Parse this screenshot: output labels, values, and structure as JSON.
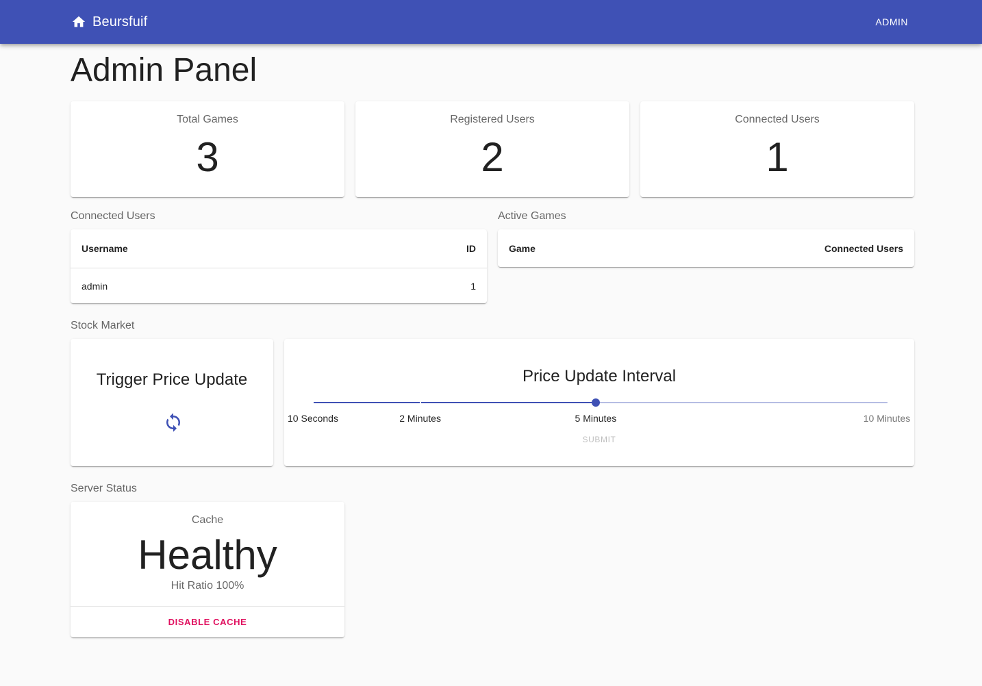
{
  "appbar": {
    "brand": "Beursfuif",
    "nav_admin": "ADMIN",
    "color": "#3f51b5"
  },
  "page": {
    "title": "Admin Panel"
  },
  "stats": [
    {
      "label": "Total Games",
      "value": "3"
    },
    {
      "label": "Registered Users",
      "value": "2"
    },
    {
      "label": "Connected Users",
      "value": "1"
    }
  ],
  "connected_users": {
    "section_label": "Connected Users",
    "columns": [
      "Username",
      "ID"
    ],
    "rows": [
      {
        "username": "admin",
        "id": "1"
      }
    ]
  },
  "active_games": {
    "section_label": "Active Games",
    "columns": [
      "Game",
      "Connected Users"
    ],
    "rows": []
  },
  "stock_market": {
    "section_label": "Stock Market",
    "trigger_title": "Trigger Price Update",
    "refresh_icon": "refresh-icon",
    "interval": {
      "title": "Price Update Interval",
      "marks": [
        {
          "label": "10 Seconds",
          "seconds": 10
        },
        {
          "label": "2 Minutes",
          "seconds": 120
        },
        {
          "label": "5 Minutes",
          "seconds": 300
        },
        {
          "label": "10 Minutes",
          "seconds": 600
        }
      ],
      "selected_seconds": 300,
      "submit_label": "SUBMIT"
    }
  },
  "server_status": {
    "section_label": "Server Status",
    "cache_label": "Cache",
    "cache_value": "Healthy",
    "hit_ratio": "Hit Ratio 100%",
    "disable_label": "DISABLE CACHE",
    "disable_color": "#e0105f"
  }
}
